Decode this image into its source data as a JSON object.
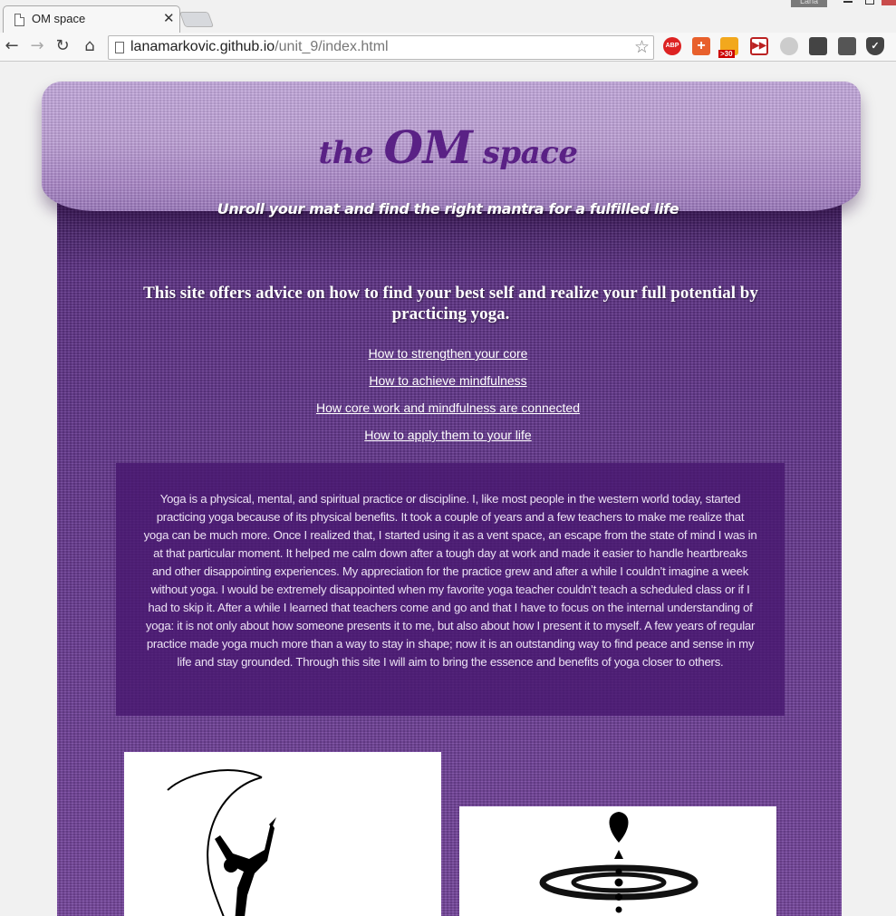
{
  "browser": {
    "tab_title": "OM space",
    "tab_close": "✕",
    "user_badge": "Lana",
    "url_host": "lanamarkovic.github.io",
    "url_path": "/unit_9/index.html",
    "ext_abp": "ABP",
    "ext_plus": "+",
    "ext_30_top": "",
    "ext_30_badge": ">30",
    "ext_play": "▶▶"
  },
  "page": {
    "title_prefix": "the ",
    "title_om": "OM",
    "title_suffix": " space",
    "tagline": "Unroll your mat and find the right mantra for a fulfilled life",
    "intro": "This site offers advice on how to find your best self and realize your full potential by practicing yoga.",
    "nav_links": [
      "How to strengthen your core",
      "How to achieve mindfulness",
      "How core work and mindfulness are connected",
      "How to apply them to your life"
    ],
    "essay": "Yoga is a physical, mental, and spiritual practice or discipline. I, like most people in the western world today, started practicing yoga because of its physical benefits. It took a couple of years and a few teachers to make me realize that yoga can be much more. Once I realized that, I started using it as a vent space, an escape from the state of mind I was in at that particular moment. It helped me calm down after a tough day at work and made it easier to handle heartbreaks and other disappointing experiences. My appreciation for the practice grew and after a while I couldn’t imagine a week without yoga. I would be extremely disappointed when my favorite yoga teacher couldn’t teach a scheduled class or if I had to skip it. After a while I learned that teachers come and go and that I have to focus on the internal understanding of yoga: it is not only about how someone presents it to me, but also about how I present it to myself. A few years of regular practice made yoga much more than a way to stay in shape; now it is an outstanding way to find peace and sense in my life and stay grounded. Through this site I will aim to bring the essence and benefits of yoga closer to others."
  },
  "colors": {
    "title_purple": "#5a2185",
    "mat_purple": "#6a3a92",
    "roll_lilac": "#b497cf",
    "essay_bg": "#46166e"
  },
  "icons": {
    "tab_page": "page-icon",
    "back": "arrow-left-icon",
    "forward": "arrow-right-icon",
    "reload": "reload-icon",
    "home": "home-icon",
    "bookmark": "star-icon",
    "left_image": "yoga-pose-moon-icon",
    "right_image": "meditation-drop-icon"
  }
}
